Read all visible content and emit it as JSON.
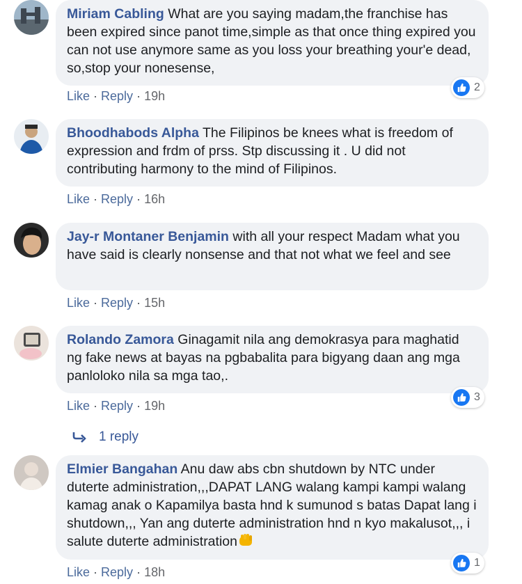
{
  "actions": {
    "like": "Like",
    "reply": "Reply",
    "sep": " · "
  },
  "comments": [
    {
      "author": "Miriam Cabling",
      "text": "What are you saying madam,the franchise has been expired since panot time,simple as that once thing expired you can not use anymore same as you loss your breathing your'e dead, so,stop your nonesense,",
      "time": "19h",
      "reactions": "2"
    },
    {
      "author": "Bhoodhabods Alpha",
      "text": "The Filipinos be knees what is freedom of expression and frdm of prss. Stp discussing it . U did not contributing harmony to the mind of Filipinos.",
      "time": "16h"
    },
    {
      "author": "Jay-r Montaner Benjamin",
      "text": "with all your respect Madam what you have said is clearly nonsense and that not what we feel and see",
      "time": "15h"
    },
    {
      "author": "Rolando Zamora",
      "text": "Ginagamit nila ang demokrasya para maghatid ng fake news at bayas na pgbabalita para bigyang daan ang mga panloloko nila sa mga tao,.",
      "time": "19h",
      "reactions": "3",
      "replies": "1 reply"
    },
    {
      "author": "Elmier Bangahan",
      "text": "Anu daw abs cbn shutdown by NTC under duterte administration,,,DAPAT LANG walang kampi kampi walang kamag anak o Kapamilya basta hnd k sumunod s batas Dapat lang i shutdown,,, Yan ang duterte administration hnd n kyo makalusot,,, i salute duterte administration",
      "time": "18h",
      "reactions": "1"
    }
  ],
  "colors": {
    "author": "#385898",
    "bubble": "#f0f2f5",
    "like_blue": "#1877f2"
  },
  "icons": [
    "like-icon",
    "reply-arrow-icon",
    "fist-emoji-icon"
  ]
}
